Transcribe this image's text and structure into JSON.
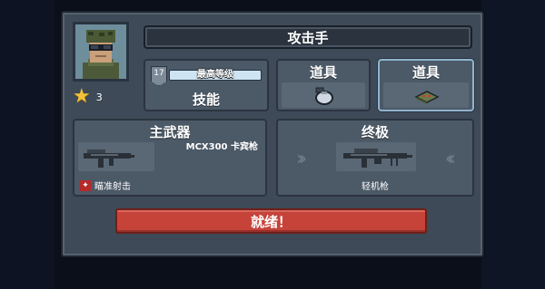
{
  "header": {
    "title": "攻击手"
  },
  "rank": {
    "value": "3",
    "icon": "star-icon"
  },
  "skill": {
    "level_badge": "17",
    "level_text": "最高等级",
    "label": "技能"
  },
  "items": [
    {
      "label": "道具",
      "icon": "grenade-icon"
    },
    {
      "label": "道具",
      "icon": "ammo-box-icon"
    }
  ],
  "primary_weapon": {
    "label": "主武器",
    "name": "MCX300 卡宾枪",
    "perk": "瞄准射击",
    "icon": "rifle-icon"
  },
  "ultimate": {
    "label": "终极",
    "name": "轻机枪",
    "icon": "machine-gun-icon"
  },
  "ready_button": {
    "label": "就绪！"
  },
  "colors": {
    "ready": "#c6433a",
    "star": "#f3c23a",
    "panel": "#3e4a57",
    "card": "#4c5967"
  }
}
